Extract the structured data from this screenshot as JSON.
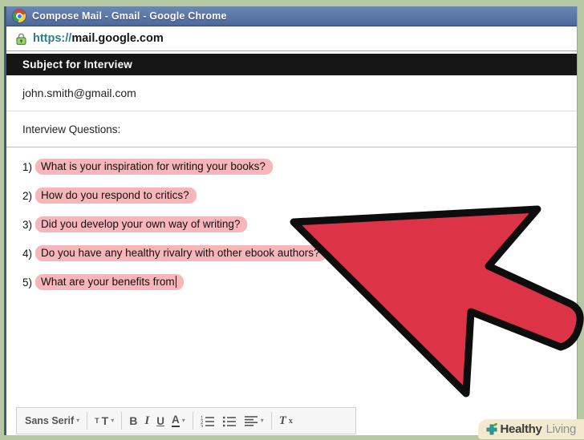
{
  "browser": {
    "window_title": "Compose Mail - Gmail - Google Chrome",
    "url_scheme": "https://",
    "url_host": "mail.google.com"
  },
  "compose": {
    "subject": "Subject for Interview",
    "recipient": "john.smith@gmail.com",
    "intro": "Interview Questions:",
    "questions": [
      {
        "num": "1)",
        "text": "What is your inspiration for writing your books?"
      },
      {
        "num": "2)",
        "text": "How do you respond to critics?"
      },
      {
        "num": "3)",
        "text": "Did you develop your own way of writing?"
      },
      {
        "num": "4)",
        "text": "Do you have any healthy rivalry with other ebook authors?"
      },
      {
        "num": "5)",
        "text": "What are your benefits from",
        "cursor": true
      }
    ]
  },
  "toolbar": {
    "font_name": "Sans Serif",
    "size_small_t": "T",
    "size_big_t": "T",
    "bold": "B",
    "italic": "I",
    "underline": "U",
    "text_color": "A",
    "clear_t": "T",
    "clear_x": "x",
    "dropdown_glyph": "▾"
  },
  "branding": {
    "bold_part": "Healthy",
    "light_part": "Living"
  },
  "colors": {
    "arrow_red": "#dc3446",
    "highlight_pink": "#f7b6b9",
    "frame_green": "#b6c9a2",
    "titlebar_blue": "#5a76a6",
    "subjectbar_black": "#161616",
    "url_scheme_teal": "#2e7d8c"
  }
}
